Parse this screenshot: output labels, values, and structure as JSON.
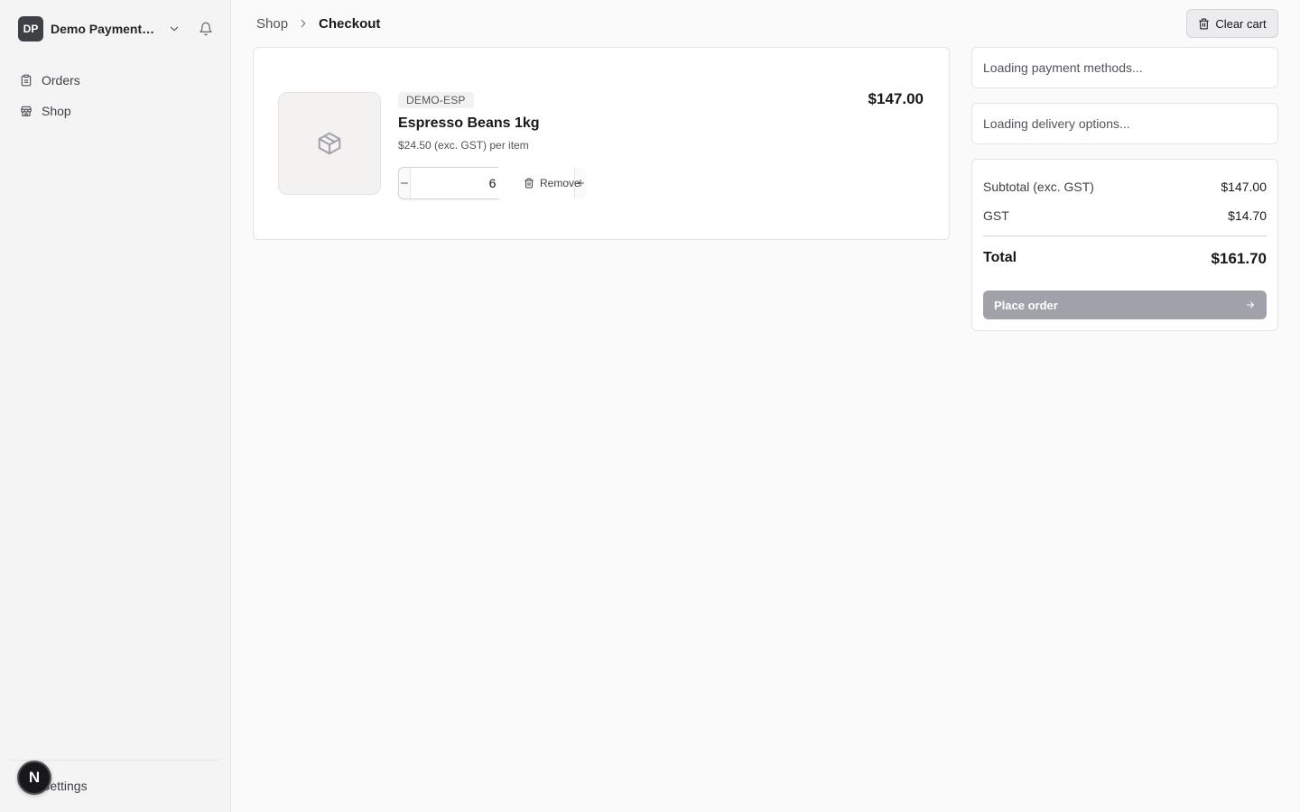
{
  "sidebar": {
    "org": {
      "initials": "DP",
      "name": "Demo Payments Pty Ltd"
    },
    "items": [
      {
        "label": "Orders",
        "icon": "clipboard-icon"
      },
      {
        "label": "Shop",
        "icon": "store-icon"
      }
    ],
    "settings_label": "Settings",
    "fab_label": "N"
  },
  "header": {
    "breadcrumb": {
      "parent": "Shop",
      "current": "Checkout"
    },
    "clear_cart_label": "Clear cart"
  },
  "cart": {
    "item": {
      "sku": "DEMO-ESP",
      "name": "Espresso Beans 1kg",
      "unit_price": "$24.50 (exc. GST) per item",
      "quantity": "6",
      "line_total": "$147.00",
      "remove_label": "Remove"
    }
  },
  "checkout": {
    "payment_loading": "Loading payment methods...",
    "delivery_loading": "Loading delivery options...",
    "summary": {
      "subtotal_label": "Subtotal (exc. GST)",
      "subtotal_value": "$147.00",
      "gst_label": "GST",
      "gst_value": "$14.70",
      "total_label": "Total",
      "total_value": "$161.70",
      "place_order_label": "Place order"
    }
  },
  "colors": {
    "accent_disabled": "#a1a1aa",
    "dark": "#18181b"
  }
}
